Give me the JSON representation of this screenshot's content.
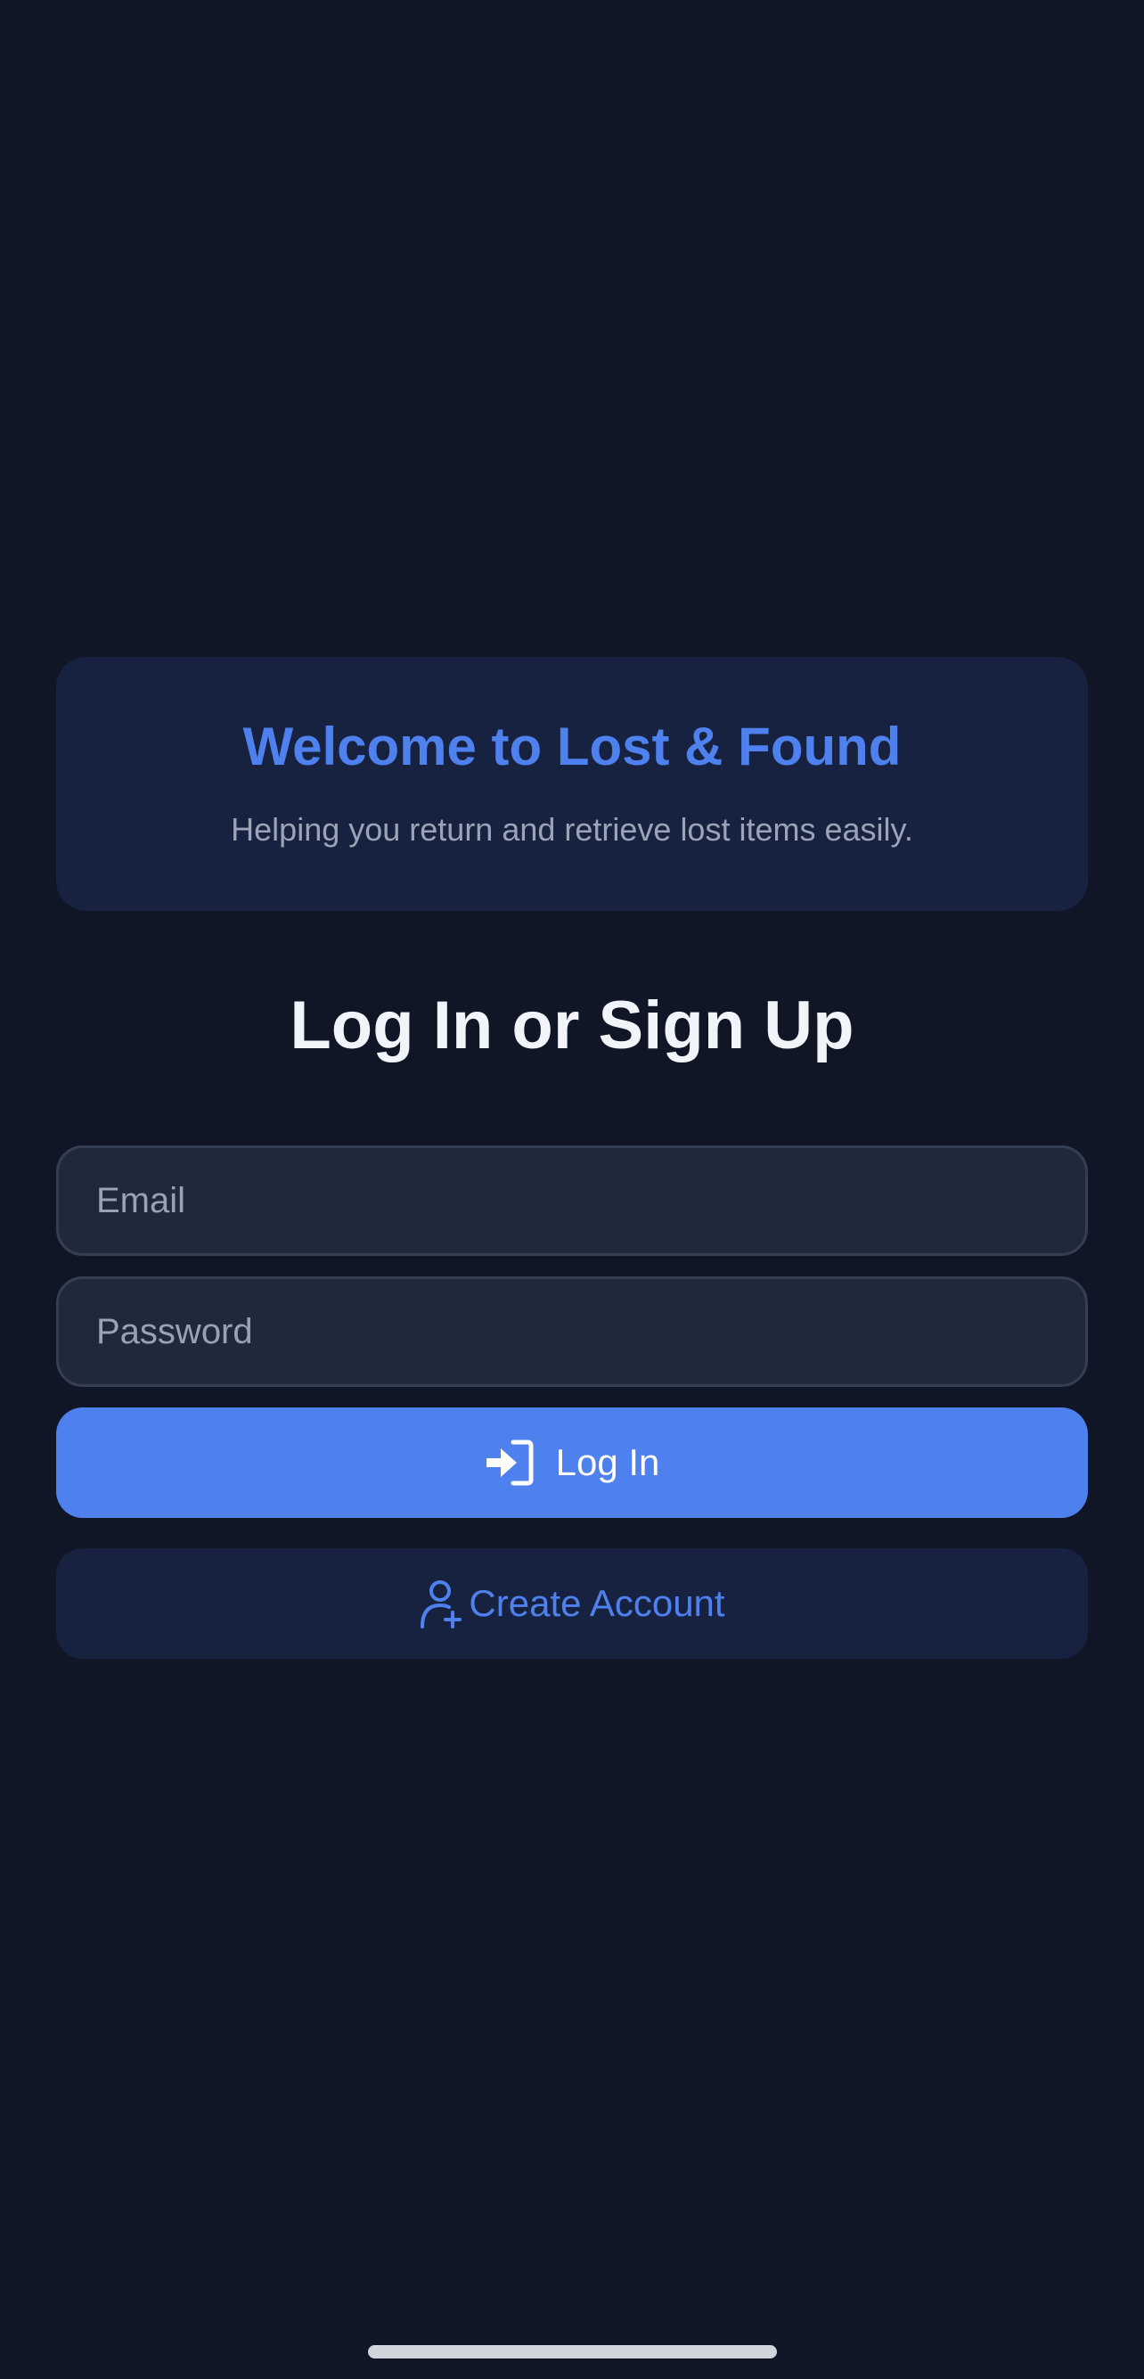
{
  "welcome": {
    "title": "Welcome to Lost & Found",
    "subtitle": "Helping you return and retrieve lost items easily."
  },
  "auth": {
    "heading": "Log In or Sign Up",
    "email_placeholder": "Email",
    "password_placeholder": "Password",
    "login_label": "Log In",
    "login_icon": "log-in-icon",
    "create_label": "Create Account",
    "create_icon": "user-plus-icon"
  },
  "colors": {
    "background": "#111627",
    "card": "#172240",
    "accent": "#4f81ee",
    "input_bg": "#1f293b"
  }
}
